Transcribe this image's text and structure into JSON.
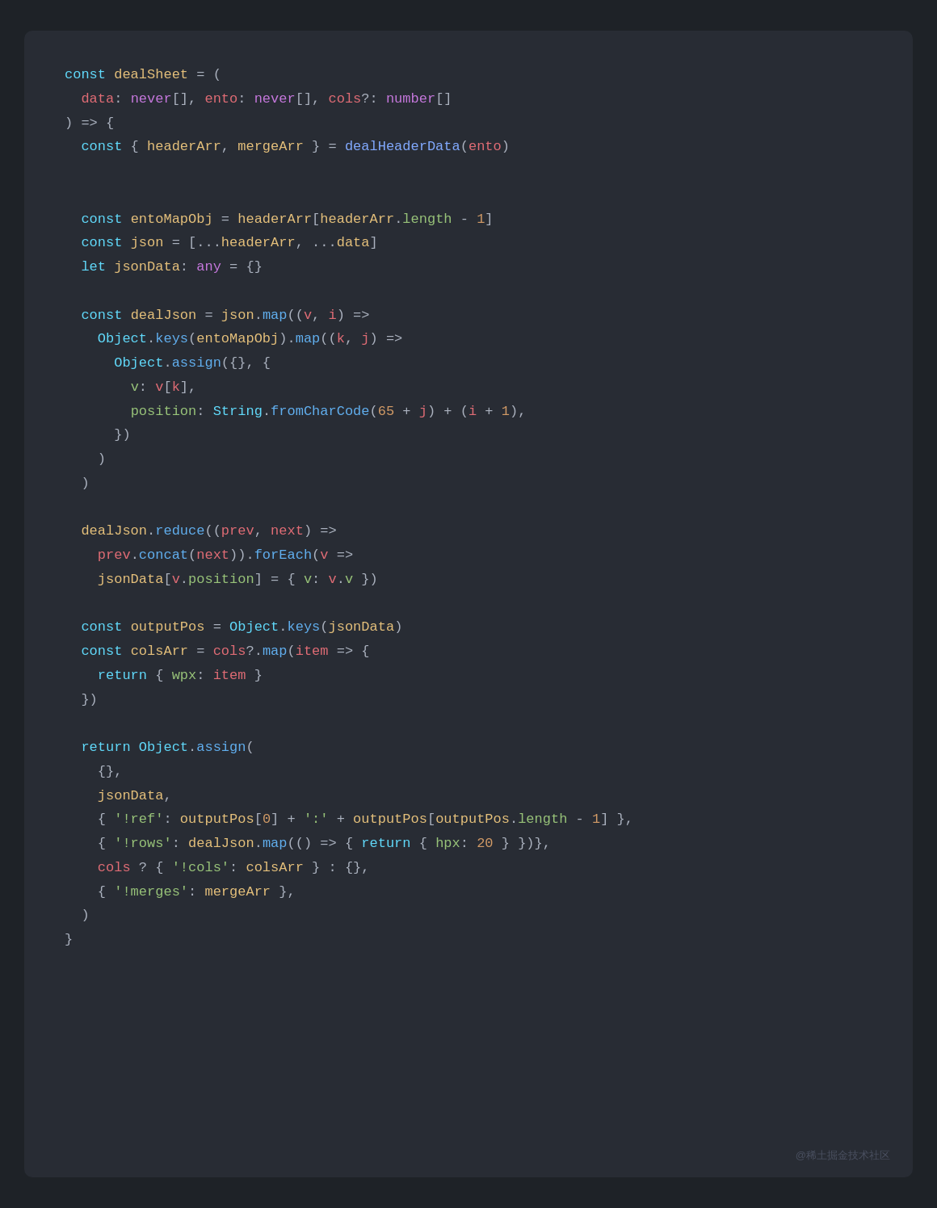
{
  "code": {
    "watermark": "@稀土掘金技术社区"
  }
}
